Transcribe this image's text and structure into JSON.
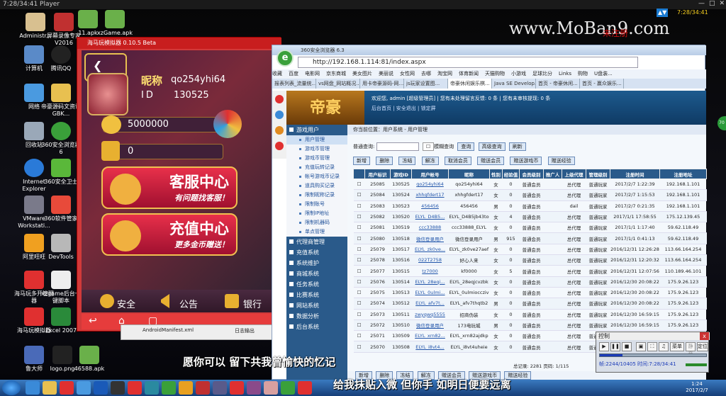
{
  "player": {
    "title": "7:28/34:41 Player"
  },
  "watermark": {
    "site": "www.MoBan9.com",
    "unregistered": "未注册",
    "netspeed": "",
    "time": "7:28/34:41"
  },
  "desktop_icons": [
    {
      "label": "Administr..."
    },
    {
      "label": "屏幕录像专家 V2016"
    },
    {
      "label": "11.apk"
    },
    {
      "label": "xzGame.apk"
    },
    {
      "label": "计算机"
    },
    {
      "label": "腾讯QQ"
    },
    {
      "label": "网络"
    },
    {
      "label": "帝豪源码文资讯GBK..."
    },
    {
      "label": "回收站"
    },
    {
      "label": "360安全浏览器6"
    },
    {
      "label": "Internet Explorer"
    },
    {
      "label": "360安全卫士"
    },
    {
      "label": "VMware Workstati..."
    },
    {
      "label": "360软件管家"
    },
    {
      "label": "阿里旺旺"
    },
    {
      "label": "DevTools"
    },
    {
      "label": "海马玩多开管理器"
    },
    {
      "label": "xzgame后台一键脚本"
    },
    {
      "label": "海马玩模拟器"
    },
    {
      "label": "Excel 2007"
    },
    {
      "label": "鲁大师"
    },
    {
      "label": "logo.png"
    },
    {
      "label": "46588.apk"
    }
  ],
  "emulator": {
    "title": "海马玩模拟器 0.10.5 Beta",
    "nickname_label": "昵称",
    "nickname": "qo254yhi64",
    "id_label": "ID",
    "id": "130525",
    "coins": "5000000",
    "second": "0",
    "service_title": "客服中心",
    "service_sub": "有问题找客服！",
    "recharge_title": "充值中心",
    "recharge_sub": "更多金币赠送！",
    "nav": [
      "安全",
      "公告",
      "银行"
    ],
    "files": [
      "AndroidManifest.xml",
      "日志输出"
    ]
  },
  "browser": {
    "title": "360安全浏览器 6.3",
    "url": "http://192.168.1.114:81/index.aspx",
    "favorites": [
      "收藏",
      "百度",
      "电影网",
      "京东商城",
      "美女图片",
      "美丽说",
      "女性网",
      "去哪",
      "淘宝网",
      "体育新闻",
      "天猫购物",
      "小游戏",
      "足球比分",
      "Links",
      "购物",
      "U盘装..."
    ],
    "tabs": [
      "报表列表_流量统...",
      "vs网盘_网站概况...",
      "用卡帝豪源码-网...",
      "js玩家设置图...",
      "帝豪休闲娱乐棋...",
      "Java SE Develop...",
      "首页 - 帝豪休闲...",
      "首页 - 赢众娱乐..."
    ],
    "active_tab": 4
  },
  "site": {
    "logo": "帝豪",
    "sub": "帝豪",
    "welcome": "欢迎您, admin [超级管理员] | 您有未处理留言反馈: 0 条 | 您有未审核提现: 0 条",
    "links": "后台首页 | 安全退出 | 锁定屏"
  },
  "menu": [
    {
      "group": "游戏用户",
      "items": [
        "用户管理",
        "游戏币管理",
        "游戏币管理",
        "充值玩转记录",
        "帐号游戏币记录",
        "道具购买记录",
        "限制昵称记录",
        "限制账号",
        "限制IP地址",
        "限制机器码",
        "单点管理"
      ]
    },
    {
      "group": "代理商管理",
      "items": []
    },
    {
      "group": "充值系统",
      "items": []
    },
    {
      "group": "系统维护",
      "items": []
    },
    {
      "group": "商城系统",
      "items": []
    },
    {
      "group": "任务系统",
      "items": []
    },
    {
      "group": "比赛系统",
      "items": []
    },
    {
      "group": "网站系统",
      "items": []
    },
    {
      "group": "数据分析",
      "items": []
    },
    {
      "group": "后台系统",
      "items": []
    }
  ],
  "content": {
    "crumb": "你当前位置：用户系统 - 用户管理",
    "search_label": "普通查询:",
    "fuzzy": "模糊查询",
    "buttons": [
      "查询",
      "高级查询",
      "刷新"
    ],
    "toolbar": [
      "新增",
      "删除",
      "冻结",
      "解冻",
      "取消会员",
      "",
      "赠送会员",
      "赠送游戏币",
      "赠送经验",
      "赠送经验"
    ],
    "headers": [
      "",
      "用户标识",
      "游戏ID",
      "用户帐号",
      "昵称",
      "性别",
      "经验值",
      "会员级别",
      "推广人",
      "上级代理",
      "管理级别",
      "注册时间",
      "注册地址"
    ],
    "rows": [
      [
        "25085",
        "130525",
        "qo254yhi64",
        "qo254yhi64",
        "女",
        "0",
        "普通会员",
        "",
        "总代理",
        "普通玩家",
        "2017/2/7 1:22:39",
        "192.168.1.101"
      ],
      [
        "25084",
        "130524",
        "xhhgfdert17",
        "xhhgfdert17",
        "女",
        "0",
        "普通会员",
        "",
        "总代理",
        "普通玩家",
        "2017/2/7 1:15:53",
        "192.168.1.101"
      ],
      [
        "25083",
        "130523",
        "456456",
        "456456",
        "男",
        "0",
        "普通会员",
        "",
        "dail",
        "普通玩家",
        "2017/2/7 0:21:35",
        "192.168.1.101"
      ],
      [
        "25082",
        "130520",
        "ELYL_D4B5...",
        "ELYL_D4B5jb43to",
        "女",
        "4",
        "普通会员",
        "",
        "总代理",
        "普通玩家",
        "2017/1/1 17:58:55",
        "175.12.139.45"
      ],
      [
        "25081",
        "130519",
        "ccc33888",
        "ccc33888_ELYL",
        "女",
        "0",
        "普通会员",
        "",
        "总代理",
        "普通玩家",
        "2017/1/1 1:17:40",
        "59.62.118.49"
      ],
      [
        "25080",
        "130518",
        "微信登录用户",
        "微信登录用户",
        "男",
        "915",
        "普通会员",
        "",
        "总代理",
        "普通玩家",
        "2017/1/1 0:41:13",
        "59.62.118.49"
      ],
      [
        "25079",
        "130517",
        "ELYL_zk0ve...",
        "ELYL_zk0ve27aef",
        "女",
        "0",
        "普通会员",
        "",
        "总代理",
        "普通玩家",
        "2016/12/31 12:26:28",
        "113.66.164.254"
      ],
      [
        "25078",
        "130516",
        "022T2758",
        "好心人来",
        "女",
        "0",
        "普通会员",
        "",
        "总代理",
        "普通玩家",
        "2016/12/31 12:20:32",
        "113.66.164.254"
      ],
      [
        "25077",
        "130515",
        "tz7000",
        "kf0000",
        "女",
        "5",
        "普通会员",
        "",
        "总代理",
        "普通玩家",
        "2016/12/31 12:07:56",
        "110.189.46.101"
      ],
      [
        "25076",
        "130514",
        "ELYL_28eqi...",
        "ELYL_28eqjcvzbk",
        "女",
        "0",
        "普通会员",
        "",
        "总代理",
        "普通玩家",
        "2016/12/30 20:08:22",
        "175.9.26.123"
      ],
      [
        "25075",
        "130513",
        "ELYL_0ulmi...",
        "ELYL_0ulmioccziv",
        "女",
        "0",
        "普通会员",
        "",
        "总代理",
        "普通玩家",
        "2016/12/30 20:08:22",
        "175.9.26.123"
      ],
      [
        "25074",
        "130512",
        "ELYL_afv7t...",
        "ELYL_afv7thqtb2",
        "男",
        "0",
        "普通会员",
        "",
        "总代理",
        "普通玩家",
        "2016/12/30 20:08:22",
        "175.9.26.123"
      ],
      [
        "25073",
        "130511",
        "zwyqwq5555",
        "招商伪装",
        "女",
        "0",
        "普通会员",
        "",
        "总代理",
        "普通玩家",
        "2016/12/30 16:59:15",
        "175.9.26.123"
      ],
      [
        "25072",
        "130510",
        "微信登录用户",
        "173电玩城",
        "男",
        "0",
        "普通会员",
        "",
        "总代理",
        "普通玩家",
        "2016/12/30 16:59:15",
        "175.9.26.123"
      ],
      [
        "25071",
        "130509",
        "ELYL_xrn82...",
        "ELYL_xrn82ajdkp",
        "女",
        "0",
        "普通会员",
        "",
        "总代理",
        "普通玩家",
        "2016/12/30 16:59:15",
        "175.9.26.123"
      ],
      [
        "25070",
        "130508",
        "ELYL_i8vt4...",
        "ELYL_i8vt4uheie",
        "女",
        "0",
        "普通会员",
        "",
        "总代理",
        "普通玩家",
        "2016/12/30 16:59:15",
        "175.9.26.123"
      ]
    ],
    "pager": "总记录: 2281  页码: 1/115"
  },
  "control_panel": {
    "title": "控制",
    "close": "x",
    "buttons": [
      "菜单",
      "静音",
      "定位"
    ],
    "frame": "帧:2244/10405 时间:7:28/34:41"
  },
  "subtitles": {
    "line1": "愿你可以 留下共我曾愉快的忆记",
    "line2": "给我抹贴入微 但你手 如明日便要远离"
  },
  "taskbar": {
    "time": "1:24",
    "date": "2017/2/7"
  },
  "side_badge": "70"
}
